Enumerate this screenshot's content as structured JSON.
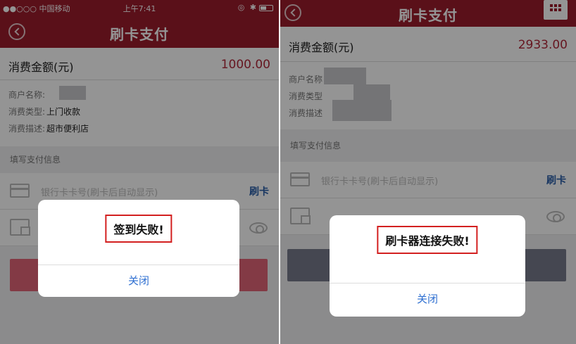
{
  "left": {
    "status": {
      "carrier": "●●○○○ 中国移动",
      "time": "上午7:41",
      "right": "◎ ✱"
    },
    "title": "刷卡支付",
    "amount_label": "消费金额(元)",
    "amount_value": "1000.00",
    "info": {
      "merchant_label": "商户名称:",
      "type_label": "消费类型:",
      "type_value": "上门收款",
      "desc_label": "消费描述:",
      "desc_value": "超市便利店"
    },
    "section_label": "填写支付信息",
    "card_placeholder": "银行卡卡号(刷卡后自动显示)",
    "swipe_label": "刷卡",
    "dialog": {
      "message": "签到失败!",
      "close_label": "关闭"
    }
  },
  "right": {
    "title": "刷卡支付",
    "amount_label": "消费金额(元)",
    "amount_value": "2933.00",
    "info": {
      "merchant_label": "商户名称",
      "type_label": "消费类型",
      "desc_label": "消费描述"
    },
    "section_label": "填写支付信息",
    "card_placeholder": "银行卡卡号(刷卡后自动显示)",
    "swipe_label": "刷卡",
    "dialog": {
      "message": "刷卡器连接失败!",
      "close_label": "关闭"
    }
  },
  "colors": {
    "brand": "#9c1c2c",
    "amount": "#b0283a",
    "link": "#2a5ea8",
    "alert_button": "#2e6fd1",
    "highlight_border": "#d32020"
  }
}
